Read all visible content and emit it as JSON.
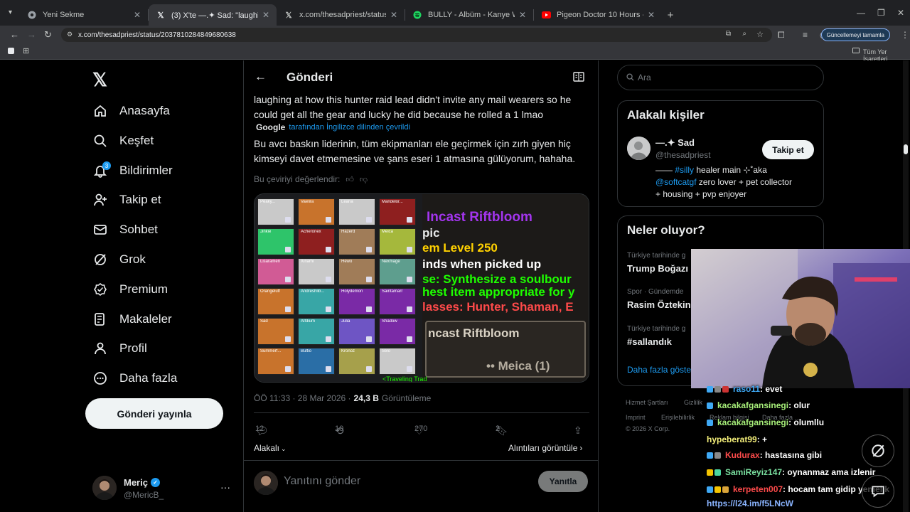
{
  "browser": {
    "tabs": [
      {
        "title": "Yeni Sekme",
        "icon": "chrome-icon"
      },
      {
        "title": "(3) X'te —.✦ Sad: \"laughing at",
        "icon": "x-icon"
      },
      {
        "title": "x.com/thesadpriest/status/2037",
        "icon": "x-icon"
      },
      {
        "title": "BULLY - Albüm - Kanye West, Y",
        "icon": "spotify-icon"
      },
      {
        "title": "Pigeon Doctor 10 Hours - YouTu",
        "icon": "youtube-icon"
      }
    ],
    "new_tab": "+",
    "url": "x.com/thesadpriest/status/2037810284849680638",
    "update_label": "Güncellemeyi tamamla",
    "bookmarks_label": "Tüm Yer İşaretleri"
  },
  "nav": {
    "items": [
      {
        "label": "Anasayfa",
        "icon": "home-icon"
      },
      {
        "label": "Keşfet",
        "icon": "search-icon"
      },
      {
        "label": "Bildirimler",
        "icon": "bell-icon",
        "badge": "3"
      },
      {
        "label": "Takip et",
        "icon": "person-add-icon"
      },
      {
        "label": "Sohbet",
        "icon": "mail-icon"
      },
      {
        "label": "Grok",
        "icon": "grok-icon"
      },
      {
        "label": "Premium",
        "icon": "verified-icon"
      },
      {
        "label": "Makaleler",
        "icon": "article-icon"
      },
      {
        "label": "Profil",
        "icon": "person-icon"
      },
      {
        "label": "Daha fazla",
        "icon": "more-circle-icon"
      }
    ],
    "post_button": "Gönderi yayınla",
    "account": {
      "name": "Meriç",
      "handle": "@MericB_",
      "more": "···"
    }
  },
  "post": {
    "header": "Gönderi",
    "text": "laughing at how this hunter raid lead didn't invite any mail wearers so he could get all the gear and lucky he did because he rolled a 1 lmao",
    "google": "Google",
    "translated_by": "tarafından İngilizce dilinden çevrildi",
    "translation": "Bu avcı baskın liderinin, tüm ekipmanları ele geçirmek için zırh giyen hiç kimseyi davet etmemesine ve şans eseri 1 atmasına gülüyorum, hahaha.",
    "rate_translation": "Bu çeviriyi değerlendir:",
    "meta_time": "ÖÖ 11:33 · 28 Mar 2026 ·",
    "views": "24,3 B",
    "views_label": "Görüntüleme",
    "counts": {
      "replies": "12",
      "reposts": "10",
      "likes": "270",
      "bookmarks": "2"
    },
    "related": "Alakalı",
    "quotes": "Alıntıları görüntüle",
    "reply_placeholder": "Yanıtını gönder",
    "reply_button": "Yanıtla",
    "image": {
      "names": [
        [
          "Peaky...",
          "Vaelira",
          "Leana",
          "Mandelor..."
        ],
        [
          "Jinkie",
          "Acheronex",
          "Hazerd",
          "Meica"
        ],
        [
          "Lisarameri",
          "Xinami",
          "Hewo",
          "Nexmage"
        ],
        [
          "Orangeluff",
          "Andreshlib...",
          "Holydemon",
          "Saintamarr"
        ],
        [
          "Sad",
          "Alfdium",
          "Julia",
          "Shadow"
        ],
        [
          "Summerf...",
          "Bultio",
          "Kronoz",
          "Selo"
        ]
      ],
      "cell_colors": [
        [
          "#c9c9c9",
          "#c8732c",
          "#c9c9c9",
          "#8e1f1f"
        ],
        [
          "#2ec46a",
          "#8e1f1f",
          "#a07c58",
          "#a5b83c"
        ],
        [
          "#d15b95",
          "#c9c9c9",
          "#a07c58",
          "#5e9e8e"
        ],
        [
          "#c8732c",
          "#38a6a6",
          "#7a2aa6",
          "#7a2aa6"
        ],
        [
          "#c8732c",
          "#38a6a6",
          "#6e55c4",
          "#7a2aa6"
        ],
        [
          "#c8732c",
          "#2a6ea6",
          "#a6a04b",
          "#c9c9c9"
        ]
      ],
      "tooltip": [
        "Incast Riftbloom",
        "pic",
        "em Level 250",
        "inds when picked up",
        "se: Synthesize a soulbour",
        "hest item appropriate for y",
        "lasses: Hunter, Shaman, E",
        "ncast Riftbloom",
        "•• Meica (1)"
      ],
      "bottom_label": "<Traveling Trad"
    }
  },
  "sidebar": {
    "search_placeholder": "Ara",
    "related_title": "Alakalı kişiler",
    "person": {
      "name": "—.✦ Sad",
      "handle": "@thesadpriest",
      "follow": "Takip et",
      "bio_1a": "—— ",
      "bio_1b": "#silly",
      "bio_1c": " healer main ⊹˚aka",
      "bio_2a": "@softcatgf",
      "bio_2b": "  zero lover + pet collector",
      "bio_3": "+ housing + pvp enjoyer"
    },
    "trends_title": "Neler oluyor?",
    "trends": [
      {
        "meta": "Türkiye tarihinde g",
        "name": "Trump Boğazı"
      },
      {
        "meta": "Spor · Gündemde",
        "name": "Rasim Öztekin"
      },
      {
        "meta": "Türkiye tarihinde g",
        "name": "#sallandık"
      }
    ],
    "more": "Daha fazla göste",
    "footer": [
      "Hizmet Şartları",
      "Gizlilik",
      "Imprint",
      "Erişilebilirlik",
      "Reklam bilgisi",
      "Daha fazla ...",
      "© 2026 X Corp."
    ]
  },
  "stream_chat": [
    {
      "user": "raso11",
      "msg": ": evet",
      "color": "#3fa9f5"
    },
    {
      "user": "kacakafgansinegi",
      "msg": ": olur",
      "color": "#a8f07a"
    },
    {
      "user": "kacakafgansinegi",
      "msg": ": olumllu",
      "color": "#a8f07a"
    },
    {
      "user": "hypeberat99",
      "msg": ": +",
      "color": "#f5f07a"
    },
    {
      "user": "Kudurax",
      "msg": ": hastasına gibi",
      "color": "#ff4b4b"
    },
    {
      "user": "SamiReyiz147",
      "msg": ": oynanmaz ama izlenir",
      "color": "#7ae0a0"
    },
    {
      "user": "kerpeten007",
      "msg": ": hocam tam gidip yemelik",
      "color": "#ff4b4b"
    }
  ],
  "stream_link": "https://l24.im/f5LNcW"
}
